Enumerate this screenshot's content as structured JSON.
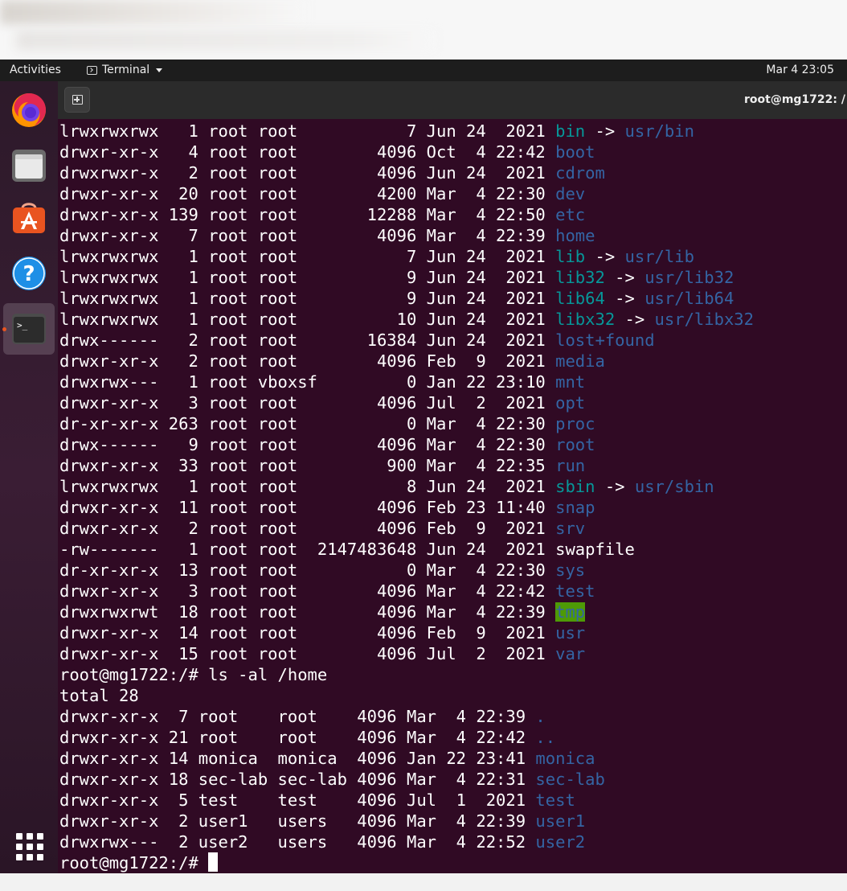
{
  "topbar": {
    "activities": "Activities",
    "app_name": "Terminal",
    "clock": "Mar 4  23:05"
  },
  "dock": {
    "items": [
      "firefox-icon",
      "files-icon",
      "software-icon",
      "help-icon",
      "terminal-icon",
      "show-apps-icon"
    ]
  },
  "window": {
    "title": "root@mg1722: /"
  },
  "colors": {
    "terminal_bg": "#300a24",
    "directory": "#3465a4",
    "symlink": "#06989a",
    "sticky_bg": "#4e9a06"
  },
  "terminal": {
    "lines": [
      [
        {
          "t": "lrwxrwxrwx   1 root root           7 Jun 24  2021 "
        },
        {
          "t": "bin",
          "c": "link"
        },
        {
          "t": " -> "
        },
        {
          "t": "usr/bin",
          "c": "dir"
        }
      ],
      [
        {
          "t": "drwxr-xr-x   4 root root        4096 Oct  4 22:42 "
        },
        {
          "t": "boot",
          "c": "dir"
        }
      ],
      [
        {
          "t": "drwxrwxr-x   2 root root        4096 Jun 24  2021 "
        },
        {
          "t": "cdrom",
          "c": "dir"
        }
      ],
      [
        {
          "t": "drwxr-xr-x  20 root root        4200 Mar  4 22:30 "
        },
        {
          "t": "dev",
          "c": "dir"
        }
      ],
      [
        {
          "t": "drwxr-xr-x 139 root root       12288 Mar  4 22:50 "
        },
        {
          "t": "etc",
          "c": "dir"
        }
      ],
      [
        {
          "t": "drwxr-xr-x   7 root root        4096 Mar  4 22:39 "
        },
        {
          "t": "home",
          "c": "dir"
        }
      ],
      [
        {
          "t": "lrwxrwxrwx   1 root root           7 Jun 24  2021 "
        },
        {
          "t": "lib",
          "c": "link"
        },
        {
          "t": " -> "
        },
        {
          "t": "usr/lib",
          "c": "dir"
        }
      ],
      [
        {
          "t": "lrwxrwxrwx   1 root root           9 Jun 24  2021 "
        },
        {
          "t": "lib32",
          "c": "link"
        },
        {
          "t": " -> "
        },
        {
          "t": "usr/lib32",
          "c": "dir"
        }
      ],
      [
        {
          "t": "lrwxrwxrwx   1 root root           9 Jun 24  2021 "
        },
        {
          "t": "lib64",
          "c": "link"
        },
        {
          "t": " -> "
        },
        {
          "t": "usr/lib64",
          "c": "dir"
        }
      ],
      [
        {
          "t": "lrwxrwxrwx   1 root root          10 Jun 24  2021 "
        },
        {
          "t": "libx32",
          "c": "link"
        },
        {
          "t": " -> "
        },
        {
          "t": "usr/libx32",
          "c": "dir"
        }
      ],
      [
        {
          "t": "drwx------   2 root root       16384 Jun 24  2021 "
        },
        {
          "t": "lost+found",
          "c": "dir"
        }
      ],
      [
        {
          "t": "drwxr-xr-x   2 root root        4096 Feb  9  2021 "
        },
        {
          "t": "media",
          "c": "dir"
        }
      ],
      [
        {
          "t": "drwxrwx---   1 root vboxsf         0 Jan 22 23:10 "
        },
        {
          "t": "mnt",
          "c": "dir"
        }
      ],
      [
        {
          "t": "drwxr-xr-x   3 root root        4096 Jul  2  2021 "
        },
        {
          "t": "opt",
          "c": "dir"
        }
      ],
      [
        {
          "t": "dr-xr-xr-x 263 root root           0 Mar  4 22:30 "
        },
        {
          "t": "proc",
          "c": "dir"
        }
      ],
      [
        {
          "t": "drwx------   9 root root        4096 Mar  4 22:30 "
        },
        {
          "t": "root",
          "c": "dir"
        }
      ],
      [
        {
          "t": "drwxr-xr-x  33 root root         900 Mar  4 22:35 "
        },
        {
          "t": "run",
          "c": "dir"
        }
      ],
      [
        {
          "t": "lrwxrwxrwx   1 root root           8 Jun 24  2021 "
        },
        {
          "t": "sbin",
          "c": "link"
        },
        {
          "t": " -> "
        },
        {
          "t": "usr/sbin",
          "c": "dir"
        }
      ],
      [
        {
          "t": "drwxr-xr-x  11 root root        4096 Feb 23 11:40 "
        },
        {
          "t": "snap",
          "c": "dir"
        }
      ],
      [
        {
          "t": "drwxr-xr-x   2 root root        4096 Feb  9  2021 "
        },
        {
          "t": "srv",
          "c": "dir"
        }
      ],
      [
        {
          "t": "-rw-------   1 root root  2147483648 Jun 24  2021 swapfile"
        }
      ],
      [
        {
          "t": "dr-xr-xr-x  13 root root           0 Mar  4 22:30 "
        },
        {
          "t": "sys",
          "c": "dir"
        }
      ],
      [
        {
          "t": "drwxr-xr-x   3 root root        4096 Mar  4 22:42 "
        },
        {
          "t": "test",
          "c": "dir"
        }
      ],
      [
        {
          "t": "drwxrwxrwt  18 root root        4096 Mar  4 22:39 "
        },
        {
          "t": "tmp",
          "c": "tmp"
        }
      ],
      [
        {
          "t": "drwxr-xr-x  14 root root        4096 Feb  9  2021 "
        },
        {
          "t": "usr",
          "c": "dir"
        }
      ],
      [
        {
          "t": "drwxr-xr-x  15 root root        4096 Jul  2  2021 "
        },
        {
          "t": "var",
          "c": "dir"
        }
      ],
      [
        {
          "t": "root@mg1722:/# ls -al /home"
        }
      ],
      [
        {
          "t": "total 28"
        }
      ],
      [
        {
          "t": "drwxr-xr-x  7 root    root    4096 Mar  4 22:39 "
        },
        {
          "t": ".",
          "c": "dir"
        }
      ],
      [
        {
          "t": "drwxr-xr-x 21 root    root    4096 Mar  4 22:42 "
        },
        {
          "t": "..",
          "c": "dir"
        }
      ],
      [
        {
          "t": "drwxr-xr-x 14 monica  monica  4096 Jan 22 23:41 "
        },
        {
          "t": "monica",
          "c": "dir"
        }
      ],
      [
        {
          "t": "drwxr-xr-x 18 sec-lab sec-lab 4096 Mar  4 22:31 "
        },
        {
          "t": "sec-lab",
          "c": "dir"
        }
      ],
      [
        {
          "t": "drwxr-xr-x  5 test    test    4096 Jul  1  2021 "
        },
        {
          "t": "test",
          "c": "dir"
        }
      ],
      [
        {
          "t": "drwxr-xr-x  2 user1   users   4096 Mar  4 22:39 "
        },
        {
          "t": "user1",
          "c": "dir"
        }
      ],
      [
        {
          "t": "drwxrwx---  2 user2   users   4096 Mar  4 22:52 "
        },
        {
          "t": "user2",
          "c": "dir"
        }
      ]
    ],
    "prompt": "root@mg1722:/# "
  }
}
